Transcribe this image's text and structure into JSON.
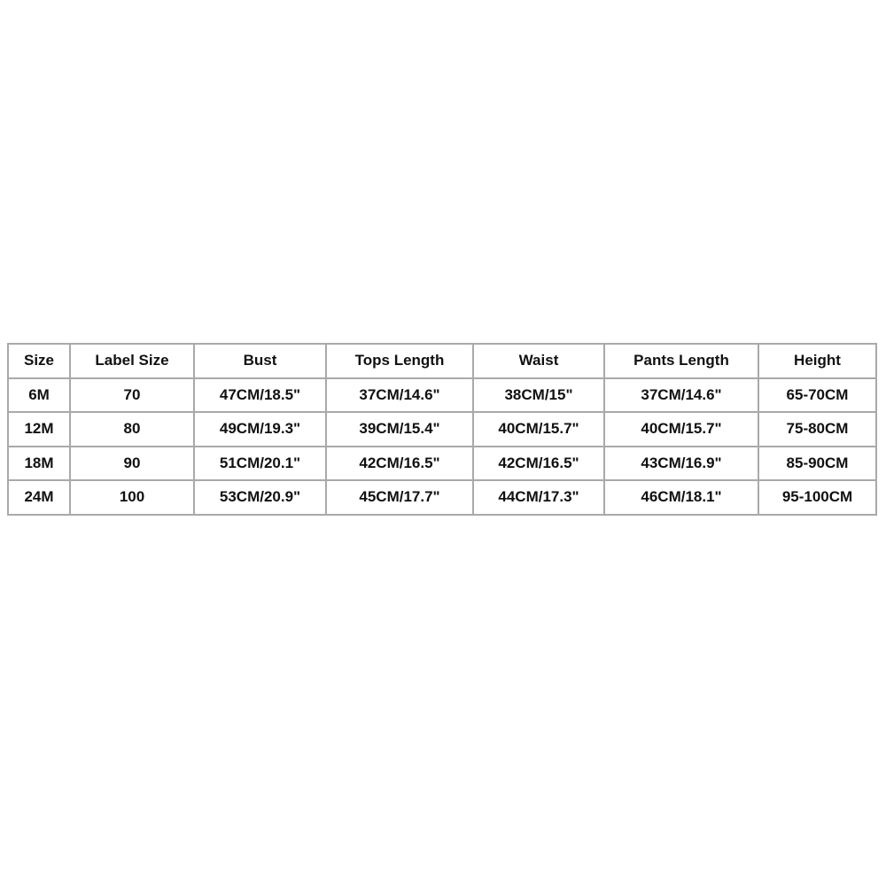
{
  "size_chart": {
    "headers": [
      "Size",
      "Label Size",
      "Bust",
      "Tops Length",
      "Waist",
      "Pants Length",
      "Height"
    ],
    "rows": [
      [
        "6M",
        "70",
        "47CM/18.5\"",
        "37CM/14.6\"",
        "38CM/15\"",
        "37CM/14.6\"",
        "65-70CM"
      ],
      [
        "12M",
        "80",
        "49CM/19.3\"",
        "39CM/15.4\"",
        "40CM/15.7\"",
        "40CM/15.7\"",
        "75-80CM"
      ],
      [
        "18M",
        "90",
        "51CM/20.1\"",
        "42CM/16.5\"",
        "42CM/16.5\"",
        "43CM/16.9\"",
        "85-90CM"
      ],
      [
        "24M",
        "100",
        "53CM/20.9\"",
        "45CM/17.7\"",
        "44CM/17.3\"",
        "46CM/18.1\"",
        "95-100CM"
      ]
    ]
  }
}
